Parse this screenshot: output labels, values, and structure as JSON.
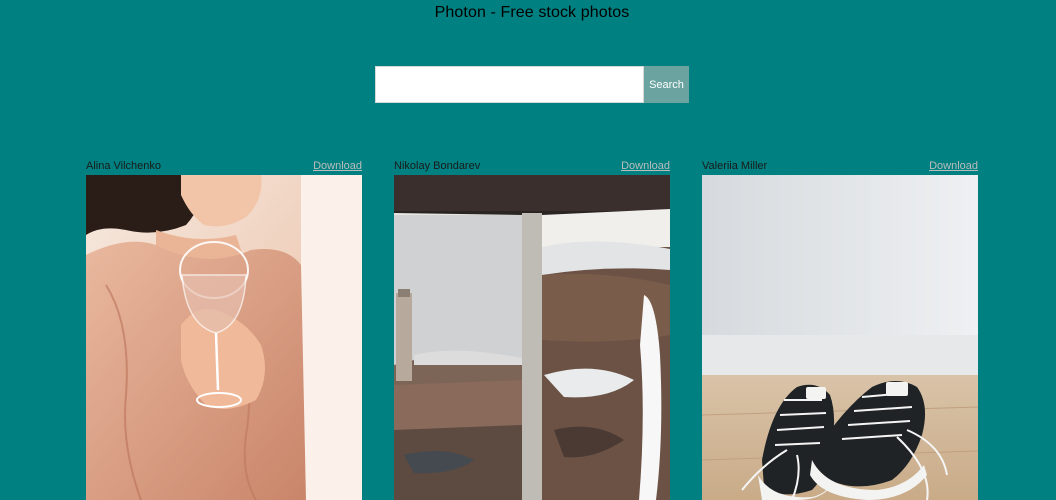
{
  "page": {
    "title": "Photon - Free stock photos"
  },
  "search": {
    "value": "",
    "placeholder": "",
    "button_label": "Search"
  },
  "photos": [
    {
      "author": "Alina Vilchenko",
      "download_label": "Download",
      "description": "woman-holding-wine-glass-photo"
    },
    {
      "author": "Nikolay Bondarev",
      "download_label": "Download",
      "description": "open-book-landscape-photo"
    },
    {
      "author": "Valeriia Miller",
      "download_label": "Download",
      "description": "black-sneakers-photo"
    }
  ],
  "colors": {
    "background": "#008080",
    "search_button": "#6aa3a0",
    "download_link": "#bcbcbc"
  }
}
